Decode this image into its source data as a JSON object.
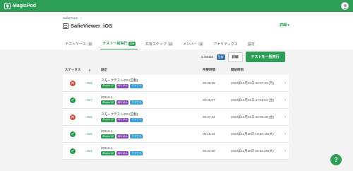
{
  "app": {
    "name": "MagicPod"
  },
  "header": {
    "breadcrumb": "SafieTeam",
    "breadcrumb_sep": "›",
    "project_title": "SafieViewer_iOS",
    "detail_menu": "詳細 ▾"
  },
  "tabs": [
    {
      "label": "テストケース",
      "count": "72"
    },
    {
      "label": "テスト一括実行",
      "count": "116"
    },
    {
      "label": "共有ステップ",
      "count": "13"
    },
    {
      "label": "メンバー",
      "count": "11"
    },
    {
      "label": "アナリティクス",
      "count": ""
    },
    {
      "label": "設定",
      "count": ""
    }
  ],
  "toolbar": {
    "count_text": "3 /26162",
    "select_label": "全体",
    "detail_label": "詳細",
    "run_label": "テストを一括実行"
  },
  "table": {
    "headers": {
      "status": "ステータス",
      "num": "#",
      "name": "設定",
      "time": "所要時間",
      "date": "開始時刻"
    },
    "rows": [
      {
        "status": "fail",
        "num": "318",
        "title": "スモークテストiOS (自動)",
        "tags": [
          "iPhone 12",
          "iOS 16.1",
          "クラウド"
        ],
        "time": "00:38:59",
        "date": "2023年12月04日 00:07:33 (月)"
      },
      {
        "status": "pass",
        "num": "317",
        "title": "iOS16.1",
        "tags": [
          "iPhone 12",
          "iOS 16.1",
          "クラウド"
        ],
        "time": "00:45:07",
        "date": "2023年12月01日 17:01:04 (金)"
      },
      {
        "status": "fail",
        "num": "316",
        "title": "スモークテストiOS (自動)",
        "tags": [
          "iPhone 12",
          "iOS 16.1",
          "クラウド"
        ],
        "time": "00:37:34",
        "date": "2023年12月01日 00:06:28 (金)"
      },
      {
        "status": "pass",
        "num": "315",
        "title": "iOS16.1",
        "tags": [
          "iPhone 12",
          "iOS 16.1",
          "クラウド"
        ],
        "time": "00:15:44",
        "date": "2023年11月30日 10:50:16 (木)"
      },
      {
        "status": "pass",
        "num": "314",
        "title": "iOS16.1",
        "tags": [
          "iPhone 12",
          "iOS 16.1",
          "クラウド"
        ],
        "time": "00:32:50",
        "date": "2023年11月30日 09:54:29 (木)"
      }
    ]
  },
  "help": {
    "label": "?"
  },
  "colors": {
    "brand": "#2e9e57",
    "fail": "#d9534f",
    "os_tag": "#8a4cb8",
    "cloud_tag": "#3a9fd8"
  }
}
